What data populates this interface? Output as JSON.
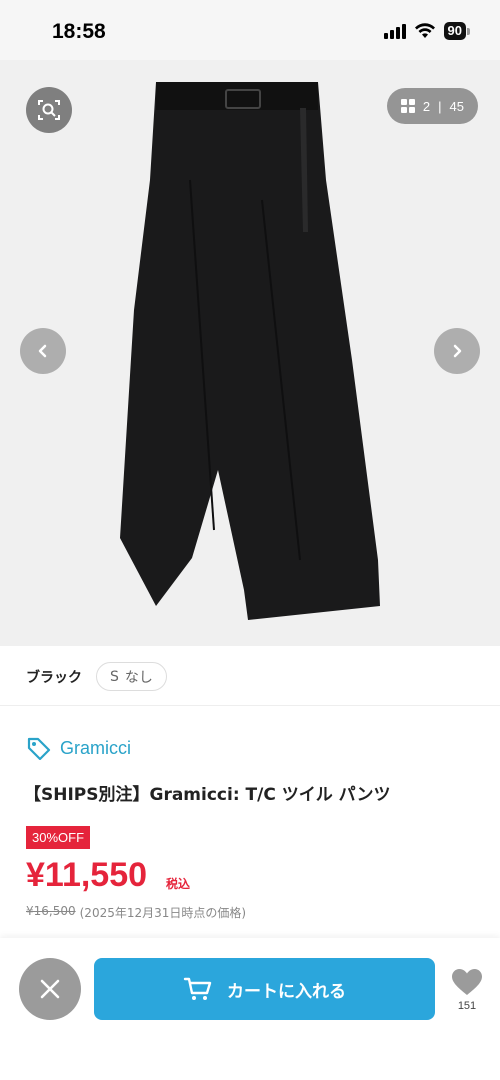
{
  "status_bar": {
    "time": "18:58",
    "battery": "90",
    "icons": [
      "signal-icon",
      "wifi-icon",
      "battery-icon"
    ]
  },
  "gallery": {
    "current": "2",
    "total": "45",
    "separator": "|",
    "icons": [
      "zoom-search-icon",
      "grid-icon",
      "chevron-left-icon",
      "chevron-right-icon"
    ]
  },
  "variant": {
    "color": "ブラック",
    "size_letter": "S",
    "size_status": "なし"
  },
  "product": {
    "brand": "Gramicci",
    "title": "【SHIPS別注】Gramicci: T/C ツイル パンツ",
    "discount": "30%OFF",
    "price": "¥11,550",
    "tax_label": "税込",
    "original_price": "¥16,500",
    "original_note": "(2025年12月31日時点の価格)"
  },
  "bottom_bar": {
    "cart_label": "カートに入れる",
    "like_count": "151",
    "icons": [
      "close-icon",
      "cart-icon",
      "heart-icon"
    ]
  },
  "colors": {
    "accent_blue": "#2ba6dc",
    "brand_blue": "#2aa3c9",
    "sale_red": "#e5243b"
  }
}
